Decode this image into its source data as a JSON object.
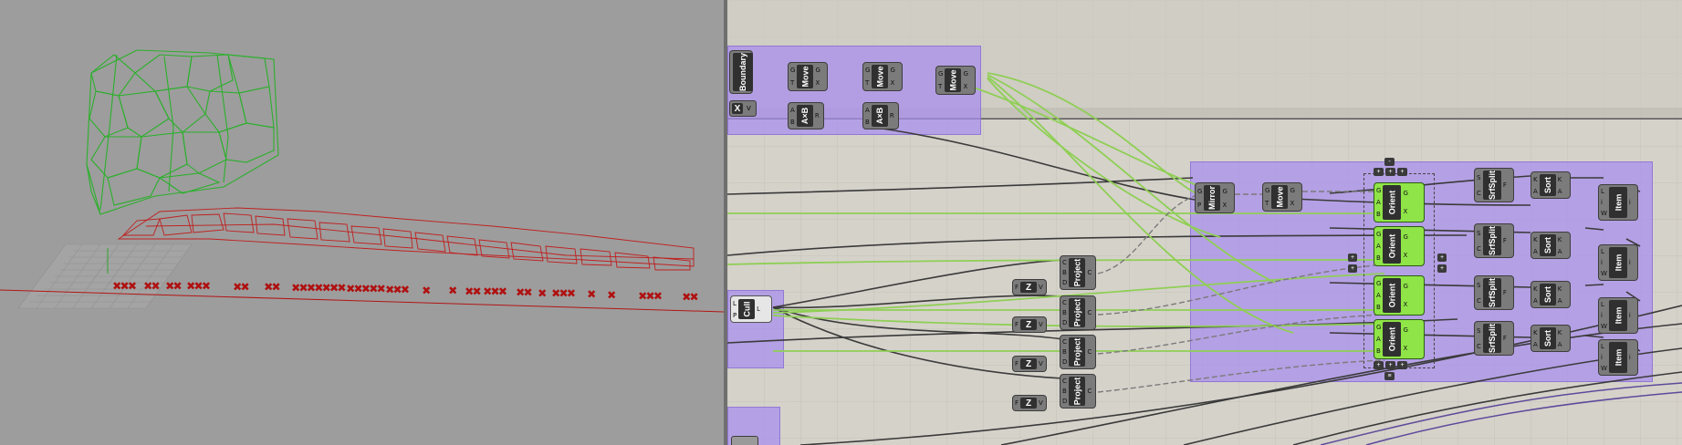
{
  "viewport": {
    "background": "#9d9d9d"
  },
  "colors": {
    "group": "#a88cee",
    "green_component": "#8fe447",
    "component": "#7b7b7b",
    "green_wire": "#8fcf55",
    "dark_wire": "#3a3a3a"
  },
  "components": {
    "boundary": {
      "label": "Boundary"
    },
    "move1": {
      "label": "Move",
      "ins": [
        "G",
        "T"
      ],
      "outs": [
        "G",
        "X"
      ]
    },
    "move2": {
      "label": "Move",
      "ins": [
        "G",
        "T"
      ],
      "outs": [
        "G",
        "X"
      ]
    },
    "move3": {
      "label": "Move",
      "ins": [
        "G",
        "T"
      ],
      "outs": [
        "G",
        "X"
      ]
    },
    "x_param": {
      "label": "X",
      "out": "V"
    },
    "axb1": {
      "label": "A×B",
      "ins": [
        "A",
        "B"
      ],
      "outs": [
        "R"
      ]
    },
    "axb2": {
      "label": "A×B",
      "ins": [
        "A",
        "B"
      ],
      "outs": [
        "R"
      ]
    },
    "cull": {
      "label": "Cull",
      "ins": [
        "L",
        "P"
      ],
      "outs": [
        "L"
      ]
    },
    "projects": [
      {
        "label": "Project",
        "ins": [
          "C",
          "B",
          "D"
        ],
        "outs": [
          "C"
        ]
      },
      {
        "label": "Project",
        "ins": [
          "C",
          "B",
          "D"
        ],
        "outs": [
          "C"
        ]
      },
      {
        "label": "Project",
        "ins": [
          "C",
          "B",
          "D"
        ],
        "outs": [
          "C"
        ]
      },
      {
        "label": "Project",
        "ins": [
          "C",
          "B",
          "D"
        ],
        "outs": [
          "C"
        ]
      }
    ],
    "zs": [
      {
        "label": "Z",
        "ins": [
          "F"
        ],
        "outs": [
          "V"
        ]
      },
      {
        "label": "Z",
        "ins": [
          "F"
        ],
        "outs": [
          "V"
        ]
      },
      {
        "label": "Z",
        "ins": [
          "F"
        ],
        "outs": [
          "V"
        ]
      },
      {
        "label": "Z",
        "ins": [
          "F"
        ],
        "outs": [
          "V"
        ]
      }
    ],
    "mirror": {
      "label": "Mirror",
      "ins": [
        "G",
        "P"
      ],
      "outs": [
        "G",
        "X"
      ]
    },
    "move4": {
      "label": "Move",
      "ins": [
        "G",
        "T"
      ],
      "outs": [
        "G",
        "X"
      ]
    },
    "orients": [
      {
        "label": "Orient",
        "ins": [
          "G",
          "A",
          "B"
        ],
        "outs": [
          "G",
          "X"
        ]
      },
      {
        "label": "Orient",
        "ins": [
          "G",
          "A",
          "B"
        ],
        "outs": [
          "G",
          "X"
        ]
      },
      {
        "label": "Orient",
        "ins": [
          "G",
          "A",
          "B"
        ],
        "outs": [
          "G",
          "X"
        ]
      },
      {
        "label": "Orient",
        "ins": [
          "G",
          "A",
          "B"
        ],
        "outs": [
          "G",
          "X"
        ]
      }
    ],
    "srfsplits": [
      {
        "label": "SrfSplit",
        "ins": [
          "S",
          "C"
        ],
        "outs": [
          "F"
        ]
      },
      {
        "label": "SrfSplit",
        "ins": [
          "S",
          "C"
        ],
        "outs": [
          "F"
        ]
      },
      {
        "label": "SrfSplit",
        "ins": [
          "S",
          "C"
        ],
        "outs": [
          "F"
        ]
      },
      {
        "label": "SrfSplit",
        "ins": [
          "S",
          "C"
        ],
        "outs": [
          "F"
        ]
      }
    ],
    "sorts": [
      {
        "label": "Sort",
        "ins": [
          "K",
          "A"
        ],
        "outs": [
          "K",
          "A"
        ]
      },
      {
        "label": "Sort",
        "ins": [
          "K",
          "A"
        ],
        "outs": [
          "K",
          "A"
        ]
      },
      {
        "label": "Sort",
        "ins": [
          "K",
          "A"
        ],
        "outs": [
          "K",
          "A"
        ]
      },
      {
        "label": "Sort",
        "ins": [
          "K",
          "A"
        ],
        "outs": [
          "K",
          "A"
        ]
      }
    ],
    "items": [
      {
        "label": "Item",
        "ins": [
          "L",
          "i",
          "W"
        ],
        "outs": [
          "i"
        ]
      },
      {
        "label": "Item",
        "ins": [
          "L",
          "i",
          "W"
        ],
        "outs": [
          "i"
        ]
      },
      {
        "label": "Item",
        "ins": [
          "L",
          "i",
          "W"
        ],
        "outs": [
          "i"
        ]
      },
      {
        "label": "Item",
        "ins": [
          "L",
          "i",
          "W"
        ],
        "outs": [
          "i"
        ]
      }
    ]
  },
  "zoom_controls": {
    "plus": "+",
    "minus": "-",
    "menu": "≡"
  }
}
